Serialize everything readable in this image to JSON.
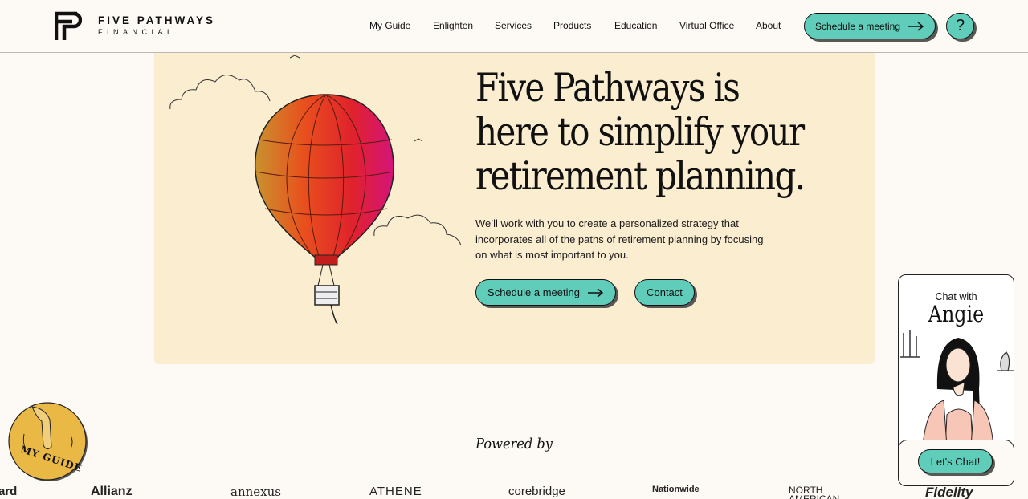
{
  "header": {
    "brand_title": "FIVE PATHWAYS",
    "brand_sub": "FINANCIAL",
    "nav": [
      "My Guide",
      "Enlighten",
      "Services",
      "Products",
      "Education",
      "Virtual Office",
      "About"
    ],
    "cta_label": "Schedule a meeting",
    "help_label": "?"
  },
  "hero": {
    "headline_lines": [
      "Five Pathways is",
      "here to simplify your",
      "retirement planning."
    ],
    "subtext_lines": [
      "We’ll work with you to create a personalized strategy that",
      "incorporates all of the paths of retirement planning by focusing",
      "on what is most important to you."
    ],
    "primary_button": "Schedule a meeting",
    "secondary_button": "Contact"
  },
  "partners": {
    "heading": "Powered by",
    "logos": [
      "ard",
      "Allianz",
      "annexus",
      "ATHENE",
      "corebridge",
      "Nationwide",
      "NORTH AMERICAN",
      "Fidelity"
    ]
  },
  "my_guide_badge": "MY GUIDE",
  "chat_widget": {
    "line1": "Chat with",
    "name": "Angie",
    "button": "Let's Chat!"
  },
  "colors": {
    "accent": "#5fcdba",
    "hero_bg": "#fbedd0",
    "page_bg": "#fdf9f4",
    "badge_gold": "#e9b845"
  }
}
